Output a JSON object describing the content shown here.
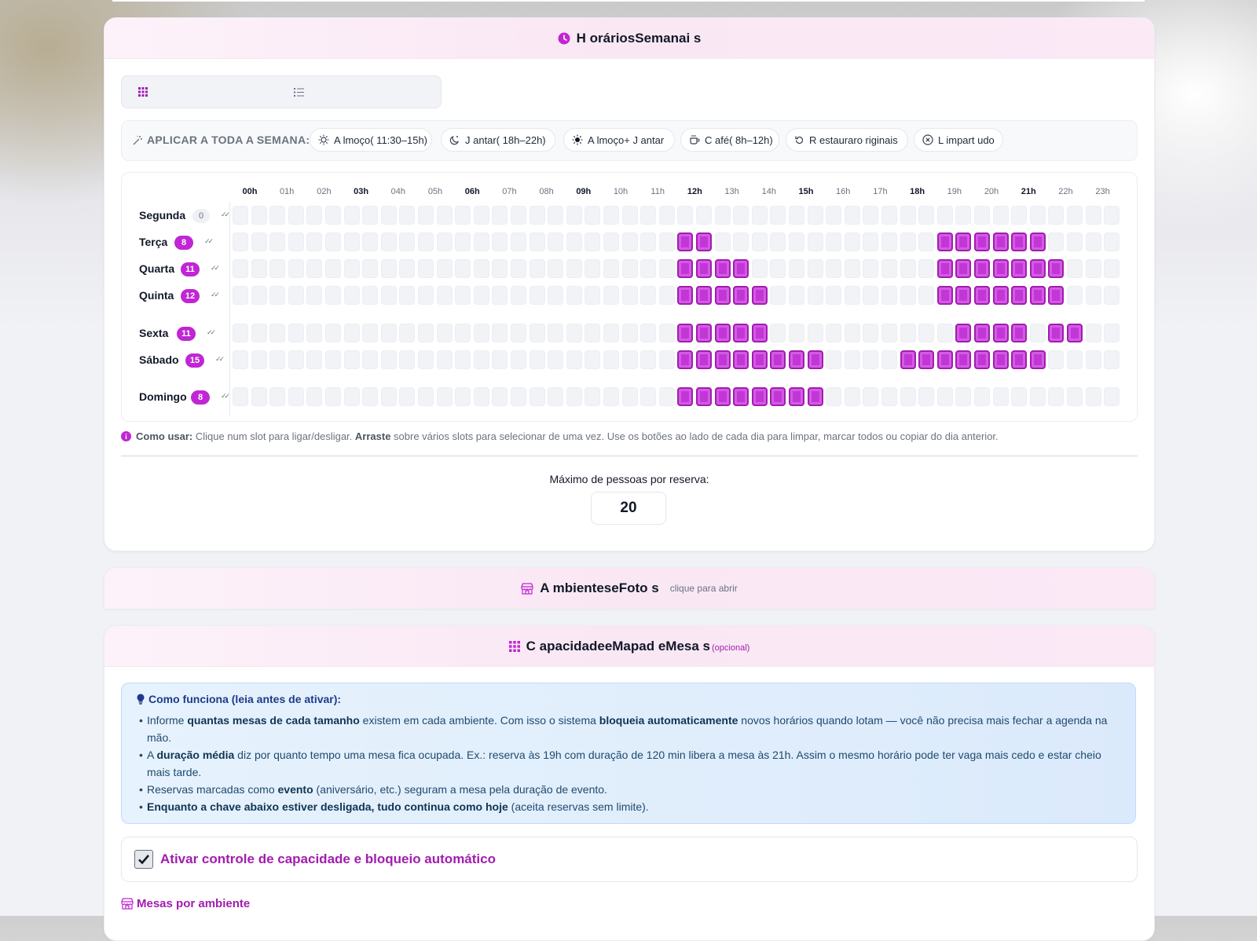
{
  "horarios": {
    "title": "H oráriosSemanai s",
    "presets_label": "APLICAR A TODA A SEMANA:",
    "presets": [
      {
        "label": "A lmoço( 11:30–15h)",
        "icon": "sun-icon"
      },
      {
        "label": "J antar( 18h–22h)",
        "icon": "moon-icon"
      },
      {
        "label": "A lmoço+ J antar",
        "icon": "sun-filled-icon"
      },
      {
        "label": "C afé( 8h–12h)",
        "icon": "coffee-icon"
      },
      {
        "label": "R estauraro riginais",
        "icon": "restore-icon"
      },
      {
        "label": "L impart udo",
        "icon": "clear-icon"
      }
    ],
    "hours": [
      "00h",
      "01h",
      "02h",
      "03h",
      "04h",
      "05h",
      "06h",
      "07h",
      "08h",
      "09h",
      "10h",
      "11h",
      "12h",
      "13h",
      "14h",
      "15h",
      "16h",
      "17h",
      "18h",
      "19h",
      "20h",
      "21h",
      "22h",
      "23h"
    ],
    "bold_hours": [
      "00h",
      "03h",
      "06h",
      "09h",
      "12h",
      "15h",
      "18h",
      "21h"
    ],
    "days": [
      {
        "name": "Segunda",
        "count": "0",
        "active": []
      },
      {
        "name": "Terça",
        "count": "8",
        "active": [
          24,
          25,
          38,
          39,
          40,
          41,
          42,
          43
        ]
      },
      {
        "name": "Quarta",
        "count": "11",
        "active": [
          24,
          25,
          26,
          27,
          38,
          39,
          40,
          41,
          42,
          43,
          44
        ]
      },
      {
        "name": "Quinta",
        "count": "12",
        "active": [
          24,
          25,
          26,
          27,
          28,
          38,
          39,
          40,
          41,
          42,
          43,
          44
        ]
      },
      {
        "name": "Sexta",
        "count": "11",
        "active": [
          24,
          25,
          26,
          27,
          28,
          39,
          40,
          41,
          42,
          44,
          45
        ]
      },
      {
        "name": "Sábado",
        "count": "15",
        "active": [
          24,
          25,
          26,
          27,
          28,
          29,
          30,
          31,
          36,
          37,
          38,
          39,
          40,
          41,
          42,
          43
        ]
      },
      {
        "name": "Domingo",
        "count": "8",
        "active": [
          24,
          25,
          26,
          27,
          28,
          29,
          30,
          31
        ]
      }
    ],
    "howto_label": "Como usar:",
    "howto_text1": " Clique num slot para ligar/desligar. ",
    "howto_bold": "Arraste",
    "howto_text2": " sobre vários slots para selecionar de uma vez. Use os botões ao lado de cada dia para limpar, marcar todos ou copiar do dia anterior.",
    "max_label": "Máximo de pessoas por reserva:",
    "max_value": "20"
  },
  "ambientes": {
    "title": "A mbienteseFoto s",
    "subtitle": "clique para abrir"
  },
  "capacidade": {
    "title": "C apacidadeeMapad eMesa s",
    "optional": "(opcional)",
    "info_title": "Como funciona (leia antes de ativar):",
    "items": [
      {
        "pre": "Informe ",
        "b1": "quantas mesas de cada tamanho",
        "mid": " existem em cada ambiente. Com isso o sistema ",
        "b2": "bloqueia automaticamente",
        "post": " novos horários quando lotam — você não precisa mais fechar a agenda na mão."
      },
      {
        "pre": "A ",
        "b1": "duração média",
        "mid": " diz por quanto tempo uma mesa fica ocupada. Ex.: reserva às 19h com duração de 120 min libera a mesa às 21h. Assim o mesmo horário pode ter vaga mais cedo e estar cheio mais tarde.",
        "b2": "",
        "post": ""
      },
      {
        "pre": "Reservas marcadas como ",
        "b1": "evento",
        "mid": " (aniversário, etc.) seguram a mesa pela duração de evento.",
        "b2": "",
        "post": ""
      },
      {
        "pre": "",
        "b1": "Enquanto a chave abaixo estiver desligada, tudo continua como hoje",
        "mid": " (aceita reservas sem limite).",
        "b2": "",
        "post": ""
      }
    ],
    "toggle_label": "Ativar controle de capacidade e bloqueio automático",
    "toggle_checked": true,
    "mesas_label": "Mesas por ambiente"
  },
  "colors": {
    "accent": "#c026d3",
    "slot_on": "#c236d6",
    "slot_off": "#f1f3f7"
  }
}
